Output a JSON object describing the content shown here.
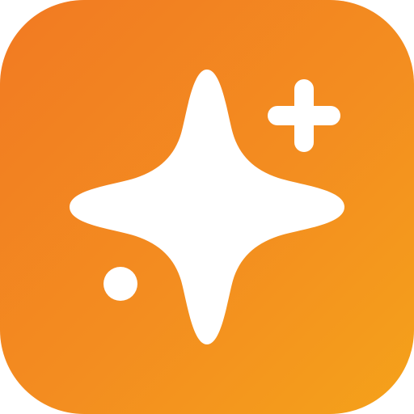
{
  "icon": {
    "name": "sparkle-app-icon",
    "gradient_start": "#f27a22",
    "gradient_end": "#f5a21a",
    "glyph_color": "#ffffff",
    "glyphs": [
      "sparkle-star-icon",
      "plus-icon",
      "dot-icon"
    ]
  }
}
